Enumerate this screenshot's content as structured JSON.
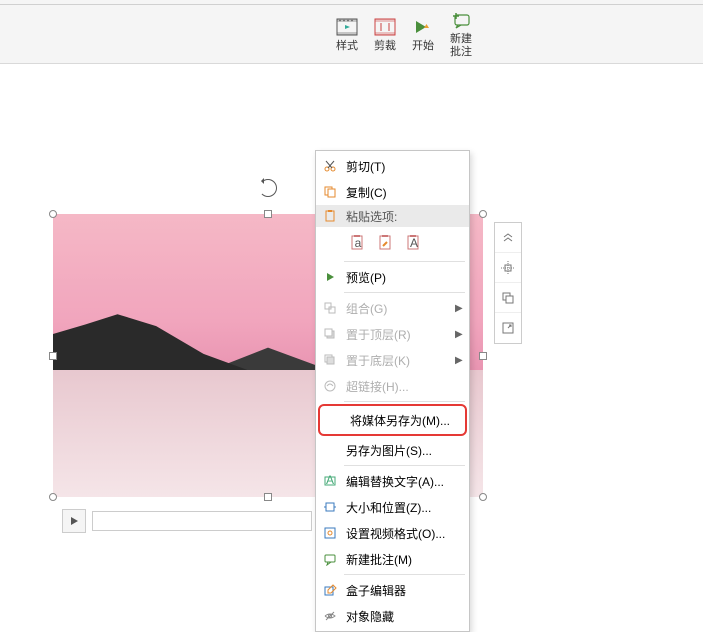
{
  "ribbon": {
    "style_label": "样式",
    "crop_label": "剪裁",
    "start_label": "开始",
    "new_comment_label": "新建\n批注"
  },
  "context_menu": {
    "cut": "剪切(T)",
    "copy": "复制(C)",
    "paste_header": "粘贴选项:",
    "preview": "预览(P)",
    "group": "组合(G)",
    "bring_front": "置于顶层(R)",
    "send_back": "置于底层(K)",
    "hyperlink": "超链接(H)...",
    "save_media_as": "将媒体另存为(M)...",
    "save_as_picture": "另存为图片(S)...",
    "edit_alt_text": "编辑替换文字(A)...",
    "size_position": "大小和位置(Z)...",
    "video_format": "设置视频格式(O)...",
    "new_comment": "新建批注(M)",
    "box_editor": "盒子编辑器",
    "hide_object": "对象隐藏"
  }
}
